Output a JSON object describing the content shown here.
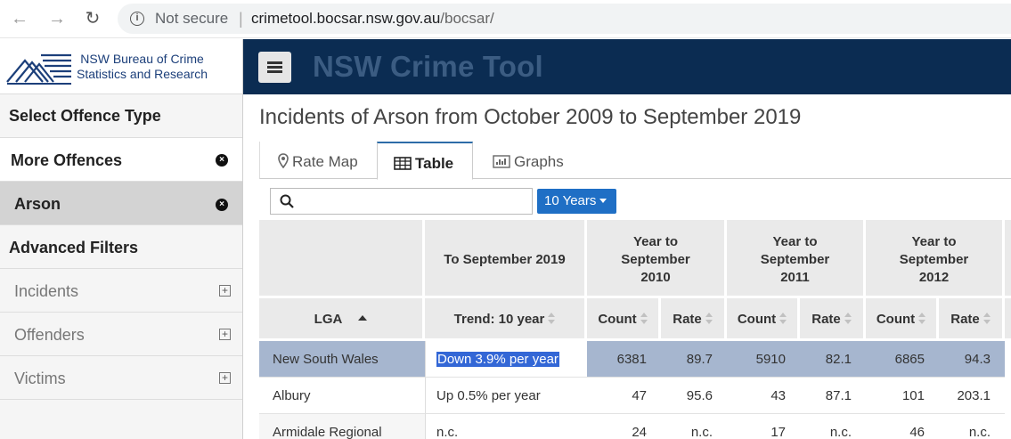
{
  "browser": {
    "not_secure": "Not secure",
    "url_host": "crimetool.bocsar.nsw.gov.au",
    "url_path": "/bocsar/"
  },
  "sidebar": {
    "logo_line1": "NSW Bureau of Crime",
    "logo_line2": "Statistics and Research",
    "select_offence": "Select Offence Type",
    "more_offences": "More Offences",
    "selected_offence": "Arson",
    "advanced_filters": "Advanced Filters",
    "filters": [
      "Incidents",
      "Offenders",
      "Victims"
    ]
  },
  "header": {
    "title": "NSW Crime Tool"
  },
  "main": {
    "page_title": "Incidents of Arson from October 2009 to September 2019",
    "tabs": [
      "Rate Map",
      "Table",
      "Graphs"
    ],
    "active_tab": "Table",
    "search_placeholder": "",
    "years_button": "10 Years"
  },
  "table": {
    "group_headers": [
      "To September 2019",
      "Year to September 2010",
      "Year to September 2011",
      "Year to September 2012"
    ],
    "col_headers": [
      "LGA",
      "Trend: 10 year",
      "Count",
      "Rate",
      "Count",
      "Rate",
      "Count",
      "Rate"
    ],
    "rows": [
      [
        "New South Wales",
        "Down 3.9% per year",
        "6381",
        "89.7",
        "5910",
        "82.1",
        "6865",
        "94.3"
      ],
      [
        "Albury",
        "Up 0.5% per year",
        "47",
        "95.6",
        "43",
        "87.1",
        "101",
        "203.1"
      ],
      [
        "Armidale Regional",
        "n.c.",
        "24",
        "n.c.",
        "17",
        "n.c.",
        "46",
        "n.c."
      ]
    ]
  },
  "colors": {
    "header_bg": "#0b2c52",
    "accent": "#1f6fc5",
    "row_highlight": "#a6b6cf"
  }
}
